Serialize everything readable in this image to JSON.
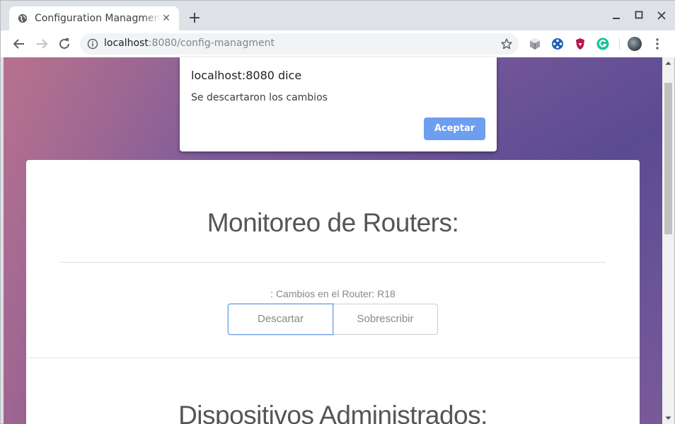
{
  "browser": {
    "tab": {
      "title": "Configuration Managment",
      "favicon": "globe-icon"
    },
    "url": {
      "host": "localhost",
      "rest": ":8080/config-managment"
    },
    "extensions": [
      "cube-extension-icon",
      "blue-extension-icon",
      "shield-extension-icon",
      "grammarly-extension-icon"
    ]
  },
  "dialog": {
    "title": "localhost:8080 dice",
    "message": "Se descartaron los cambios",
    "ok_label": "Aceptar",
    "ok_color": "#6e9ef0"
  },
  "page": {
    "title": "Monitoreo de Routers:",
    "router_label": ": Cambios en el Router: R18",
    "discard_label": "Descartar",
    "overwrite_label": "Sobrescribir",
    "section2_title": "Dispositivos Administrados:"
  }
}
